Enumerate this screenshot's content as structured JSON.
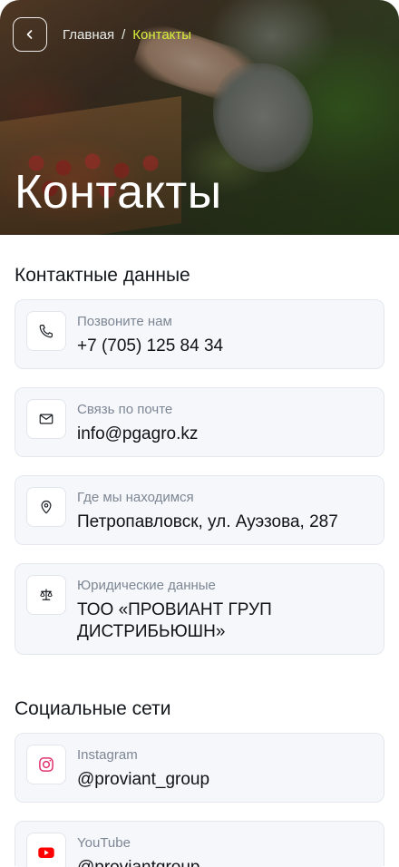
{
  "header": {
    "breadcrumb": {
      "home": "Главная",
      "separator": "/",
      "current": "Контакты"
    },
    "title": "Контакты",
    "back_icon": "chevron-left-icon"
  },
  "contacts": {
    "title": "Контактные данные",
    "items": [
      {
        "icon": "phone-icon",
        "label": "Позвоните нам",
        "value": "+7 (705) 125 84 34"
      },
      {
        "icon": "mail-icon",
        "label": "Связь по почте",
        "value": "info@pgagro.kz"
      },
      {
        "icon": "location-pin-icon",
        "label": "Где мы находимся",
        "value": "Петропавловск, ул. Ауэзова, 287"
      },
      {
        "icon": "scales-icon",
        "label": "Юридические данные",
        "value": "ТОО «ПРОВИАНТ ГРУП ДИСТРИБЬЮШН»"
      }
    ]
  },
  "social": {
    "title": "Социальные сети",
    "items": [
      {
        "icon": "instagram-icon",
        "label": "Instagram",
        "value": "@proviant_group"
      },
      {
        "icon": "youtube-icon",
        "label": "YouTube",
        "value": "@proviantgroup"
      }
    ]
  },
  "colors": {
    "accent": "#d6ef3a",
    "card_bg": "#f5f7fb",
    "instagram": "#e1306c",
    "youtube": "#ff0000"
  }
}
